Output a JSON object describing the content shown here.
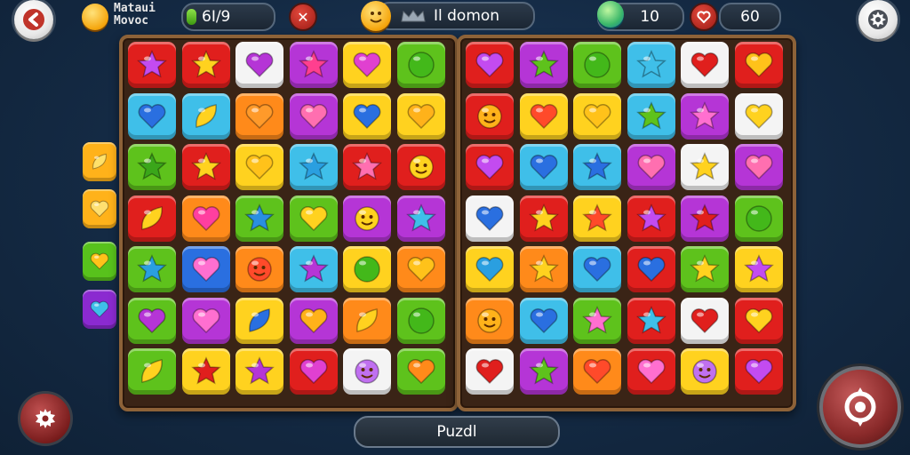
{
  "hud": {
    "title_line1": "Mataui",
    "title_line2": "Movoc",
    "progress_text": "6I/9",
    "progress_fraction": 0.12,
    "mode_text": "Il domon",
    "gems_value": "10",
    "lives_value": "60"
  },
  "footer": {
    "puzzle_label": "Puzdl"
  },
  "colors": {
    "red": "#e01f1d",
    "yellow": "#ffd21f",
    "orange": "#ff8a1a",
    "green": "#5ec21c",
    "cyan": "#3fbfe9",
    "purple": "#b535d6",
    "blue": "#2a6fe0",
    "white": "#f4f4f4",
    "darkred": "#c4121a",
    "darkpurple": "#8b2ad0"
  },
  "side_pieces": [
    {
      "bg": "#ffb21a",
      "shape": "leaf",
      "color": "#ffe16a"
    },
    {
      "bg": "#ffb21a",
      "shape": "heart",
      "color": "#ffdf70"
    },
    {
      "bg": "#58c21c",
      "shape": "heart",
      "color": "#ffc21a"
    },
    {
      "bg": "#8b2ad0",
      "shape": "heart",
      "color": "#3fbfe9"
    }
  ],
  "left_board": [
    [
      [
        "red",
        "star",
        "#c34bf0"
      ],
      [
        "red",
        "star",
        "#ffd21f"
      ],
      [
        "white",
        "heart",
        "#b535d6"
      ],
      [
        "purple",
        "star",
        "#ff3f8f"
      ],
      [
        "yellow",
        "heart",
        "#e040d0"
      ],
      [
        "green",
        "circle",
        "#43b81a"
      ]
    ],
    [
      [
        "cyan",
        "heart",
        "#2a6fe0"
      ],
      [
        "cyan",
        "leaf",
        "#ffd21f"
      ],
      [
        "orange",
        "heart",
        "#ff9a2a"
      ],
      [
        "purple",
        "heart",
        "#ff6fb0"
      ],
      [
        "yellow",
        "heart",
        "#2a6fe0"
      ],
      [
        "yellow",
        "heart",
        "#ffb21a"
      ]
    ],
    [
      [
        "green",
        "star",
        "#3aa61a"
      ],
      [
        "red",
        "star",
        "#ffd21f"
      ],
      [
        "yellow",
        "heart",
        "#ffc21a"
      ],
      [
        "cyan",
        "star",
        "#2a9fe0"
      ],
      [
        "red",
        "star",
        "#ff6fb0"
      ],
      [
        "red",
        "face",
        "#ffd21f"
      ]
    ],
    [
      [
        "red",
        "leaf",
        "#ffd21f"
      ],
      [
        "orange",
        "heart",
        "#ff3f9f"
      ],
      [
        "green",
        "star",
        "#2a8fe0"
      ],
      [
        "green",
        "heart",
        "#ffd21f"
      ],
      [
        "purple",
        "face",
        "#ffd21f"
      ],
      [
        "purple",
        "star",
        "#3fbfe9"
      ]
    ],
    [
      [
        "green",
        "star",
        "#2a9fe0"
      ],
      [
        "blue",
        "heart",
        "#ff6fd0"
      ],
      [
        "orange",
        "face",
        "#ff4a2a"
      ],
      [
        "cyan",
        "star",
        "#b535d6"
      ],
      [
        "yellow",
        "circle",
        "#43b81a"
      ],
      [
        "orange",
        "heart",
        "#ffc21a"
      ]
    ],
    [
      [
        "green",
        "heart",
        "#b535d6"
      ],
      [
        "purple",
        "heart",
        "#ff6fd0"
      ],
      [
        "yellow",
        "leaf",
        "#2a6fe0"
      ],
      [
        "purple",
        "heart",
        "#ffb21a"
      ],
      [
        "orange",
        "leaf",
        "#ffd21f"
      ],
      [
        "green",
        "circle",
        "#43b81a"
      ]
    ],
    [
      [
        "green",
        "leaf",
        "#ffd21f"
      ],
      [
        "yellow",
        "star",
        "#e01f1d"
      ],
      [
        "yellow",
        "star",
        "#b535d6"
      ],
      [
        "red",
        "heart",
        "#e040d0"
      ],
      [
        "white",
        "face",
        "#c070f0"
      ],
      [
        "green",
        "heart",
        "#ff8a1a"
      ]
    ]
  ],
  "right_board": [
    [
      [
        "red",
        "heart",
        "#c34bf0"
      ],
      [
        "purple",
        "star",
        "#5ec21c"
      ],
      [
        "green",
        "circle",
        "#43b81a"
      ],
      [
        "cyan",
        "star",
        "#3fbfe9"
      ],
      [
        "white",
        "heart",
        "#e01f1d"
      ],
      [
        "red",
        "heart",
        "#ffc21a"
      ]
    ],
    [
      [
        "red",
        "face",
        "#ffb21a"
      ],
      [
        "yellow",
        "heart",
        "#ff4a2a"
      ],
      [
        "yellow",
        "heart",
        "#ffc21a"
      ],
      [
        "cyan",
        "star",
        "#5ec21c"
      ],
      [
        "purple",
        "star",
        "#ff6fd0"
      ],
      [
        "white",
        "heart",
        "#ffd21f"
      ]
    ],
    [
      [
        "red",
        "heart",
        "#c34bf0"
      ],
      [
        "cyan",
        "heart",
        "#2a6fe0"
      ],
      [
        "cyan",
        "star",
        "#2a6fe0"
      ],
      [
        "purple",
        "heart",
        "#ff6fb0"
      ],
      [
        "white",
        "star",
        "#ffd21f"
      ],
      [
        "purple",
        "heart",
        "#ff6fb0"
      ]
    ],
    [
      [
        "white",
        "heart",
        "#2a6fe0"
      ],
      [
        "red",
        "star",
        "#ffd21f"
      ],
      [
        "yellow",
        "star",
        "#ff4a2a"
      ],
      [
        "red",
        "star",
        "#c34bf0"
      ],
      [
        "purple",
        "star",
        "#e01f1d"
      ],
      [
        "green",
        "circle",
        "#43b81a"
      ]
    ],
    [
      [
        "yellow",
        "heart",
        "#2a9fe0"
      ],
      [
        "orange",
        "star",
        "#ffd21f"
      ],
      [
        "cyan",
        "heart",
        "#2a6fe0"
      ],
      [
        "red",
        "heart",
        "#2a6fe0"
      ],
      [
        "green",
        "star",
        "#ffd21f"
      ],
      [
        "yellow",
        "star",
        "#c34bf0"
      ]
    ],
    [
      [
        "orange",
        "face",
        "#ffb21a"
      ],
      [
        "cyan",
        "heart",
        "#2a6fe0"
      ],
      [
        "green",
        "star",
        "#ff6fd0"
      ],
      [
        "red",
        "star",
        "#3fbfe9"
      ],
      [
        "white",
        "heart",
        "#e01f1d"
      ],
      [
        "red",
        "heart",
        "#ffd21f"
      ]
    ],
    [
      [
        "white",
        "heart",
        "#e01f1d"
      ],
      [
        "purple",
        "star",
        "#5ec21c"
      ],
      [
        "orange",
        "heart",
        "#ff4a2a"
      ],
      [
        "red",
        "heart",
        "#ff6fd0"
      ],
      [
        "yellow",
        "face",
        "#c070f0"
      ],
      [
        "red",
        "heart",
        "#c34bf0"
      ]
    ]
  ]
}
